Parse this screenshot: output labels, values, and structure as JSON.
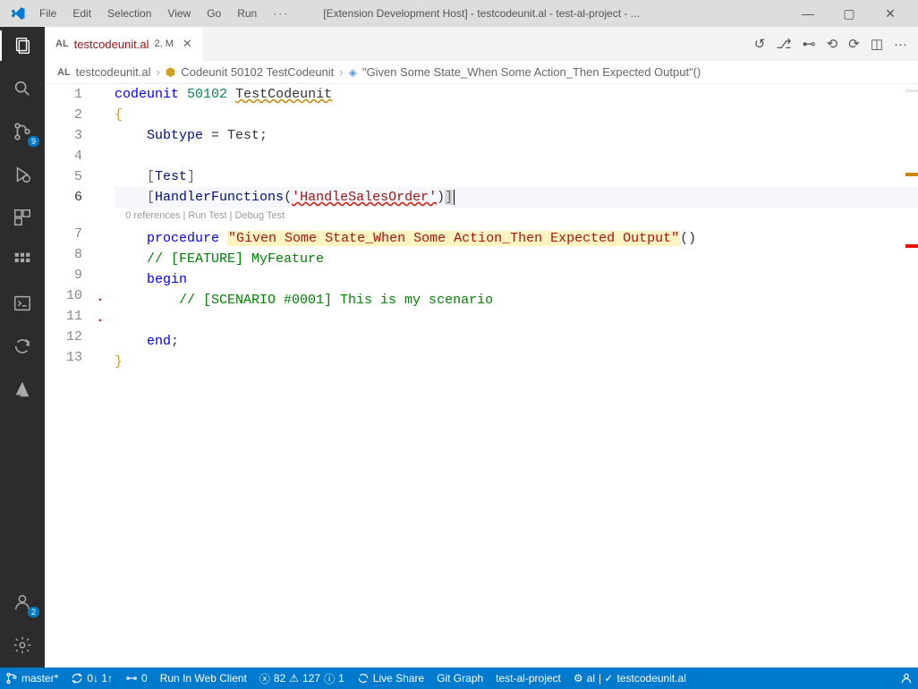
{
  "titlebar": {
    "menu": [
      "File",
      "Edit",
      "Selection",
      "View",
      "Go",
      "Run"
    ],
    "title": "[Extension Development Host] - testcodeunit.al - test-al-project - ..."
  },
  "activity": {
    "source_badge": "9",
    "accounts_badge": "2"
  },
  "tab": {
    "lang": "AL",
    "filename": "testcodeunit.al",
    "modified": "2, M"
  },
  "breadcrumb": {
    "lang": "AL",
    "file": "testcodeunit.al",
    "symbol1": "Codeunit 50102 TestCodeunit",
    "symbol2": "\"Given Some State_When Some Action_Then Expected Output\"()"
  },
  "codelens": {
    "refs": "0 references",
    "run": "Run Test",
    "debug": "Debug Test"
  },
  "code": {
    "l1_kw": "codeunit",
    "l1_num": "50102",
    "l1_name": "TestCodeunit",
    "l2": "{",
    "l3_a": "Subtype",
    "l3_b": " = Test;",
    "l5_b1": "[",
    "l5_t": "Test",
    "l5_b2": "]",
    "l6_b1": "[",
    "l6_fn": "HandlerFunctions",
    "l6_p1": "(",
    "l6_str": "'HandleSalesOrder'",
    "l6_p2": ")",
    "l6_b2": "]",
    "l7_kw": "procedure",
    "l7_name": "\"Given Some State_When Some Action_Then Expected Output\"",
    "l7_par": "()",
    "l8": "// [FEATURE] MyFeature",
    "l9": "begin",
    "l10": "// [SCENARIO #0001] This is my scenario",
    "l12": "end",
    "l12_s": ";",
    "l13": "}"
  },
  "status": {
    "branch": "master*",
    "sync": "0↓ 1↑",
    "port": "0",
    "run": "Run In Web Client",
    "err": "82",
    "warn": "127",
    "info": "1",
    "live": "Live Share",
    "git": "Git Graph",
    "proj": "test-al-project",
    "lang": "al",
    "file": "testcodeunit.al"
  }
}
